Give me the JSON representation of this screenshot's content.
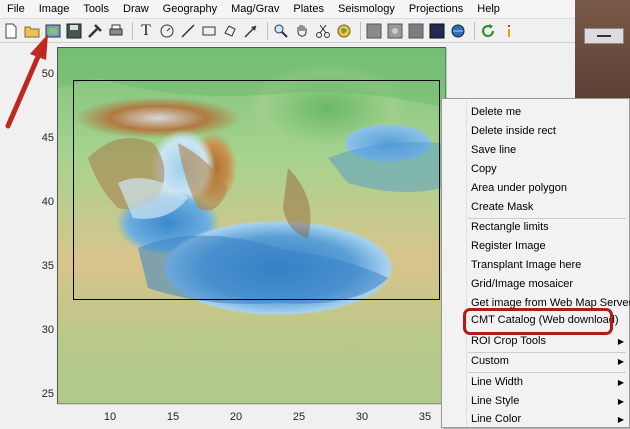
{
  "menubar": {
    "items": [
      "File",
      "Image",
      "Tools",
      "Draw",
      "Geography",
      "Mag/Grav",
      "Plates",
      "Seismology",
      "Projections",
      "Help"
    ]
  },
  "toolbar": {
    "icons": [
      "new-file-icon",
      "open-folder-icon",
      "image-icon",
      "save-icon",
      "tools-icon",
      "print-icon",
      "text-tool-icon",
      "circle-tool-icon",
      "line-tool-icon",
      "rectangle-tool-icon",
      "polygon-tool-icon",
      "arrow-tool-icon",
      "zoom-icon",
      "pan-hand-icon",
      "scissors-icon",
      "globe-icon",
      "grid-icon",
      "grid-2-icon",
      "grid-3-icon",
      "dark-square-icon",
      "sphere-icon",
      "refresh-icon",
      "info-icon"
    ],
    "text_tool_glyph": "T"
  },
  "axes": {
    "y_ticks": [
      "50",
      "45",
      "40",
      "35",
      "30",
      "25"
    ],
    "x_ticks": [
      "10",
      "15",
      "20",
      "25",
      "30",
      "35"
    ]
  },
  "context_menu": {
    "items": [
      {
        "label": "Delete me",
        "submenu": false
      },
      {
        "label": "Delete inside rect",
        "submenu": false
      },
      {
        "label": "Save line",
        "submenu": false
      },
      {
        "label": "Copy",
        "submenu": false
      },
      {
        "label": "Area under polygon",
        "submenu": false
      },
      {
        "label": "Create Mask",
        "submenu": false
      },
      {
        "label": "Rectangle limits",
        "submenu": false
      },
      {
        "label": "Register Image",
        "submenu": false
      },
      {
        "label": "Transplant Image here",
        "submenu": false
      },
      {
        "label": "Grid/Image mosaicer",
        "submenu": false
      },
      {
        "label": "Get image from Web Map Server",
        "submenu": false
      },
      {
        "label": "CMT Catalog (Web download)",
        "submenu": false
      },
      {
        "label": "ROI Crop Tools",
        "submenu": true
      },
      {
        "label": "Custom",
        "submenu": true
      },
      {
        "label": "Line Width",
        "submenu": true
      },
      {
        "label": "Line Style",
        "submenu": true
      },
      {
        "label": "Line Color",
        "submenu": true
      }
    ]
  },
  "colors": {
    "highlight": "#b11b1b",
    "annotation_arrow": "#c0281f"
  }
}
